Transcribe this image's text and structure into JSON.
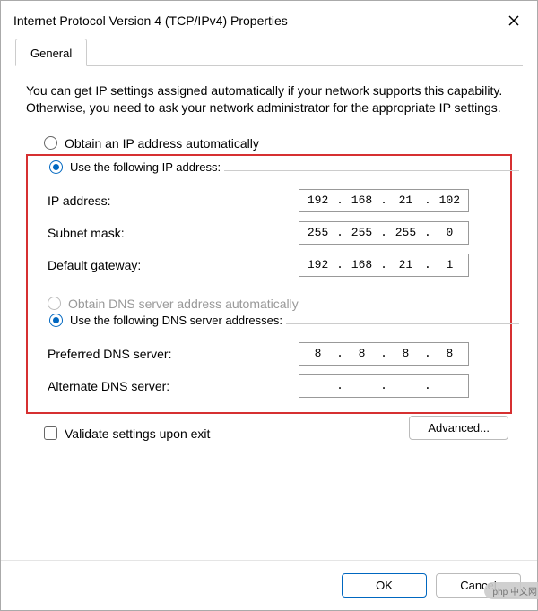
{
  "window": {
    "title": "Internet Protocol Version 4 (TCP/IPv4) Properties"
  },
  "tabs": {
    "general": "General"
  },
  "description": "You can get IP settings assigned automatically if your network supports this capability. Otherwise, you need to ask your network administrator for the appropriate IP settings.",
  "ip_section": {
    "radio_auto": "Obtain an IP address automatically",
    "radio_manual": "Use the following IP address:",
    "fields": {
      "ip_label": "IP address:",
      "ip_value": [
        "192",
        "168",
        "21",
        "102"
      ],
      "subnet_label": "Subnet mask:",
      "subnet_value": [
        "255",
        "255",
        "255",
        "0"
      ],
      "gateway_label": "Default gateway:",
      "gateway_value": [
        "192",
        "168",
        "21",
        "1"
      ]
    }
  },
  "dns_section": {
    "radio_auto": "Obtain DNS server address automatically",
    "radio_manual": "Use the following DNS server addresses:",
    "fields": {
      "preferred_label": "Preferred DNS server:",
      "preferred_value": [
        "8",
        "8",
        "8",
        "8"
      ],
      "alternate_label": "Alternate DNS server:",
      "alternate_value": [
        "",
        "",
        "",
        ""
      ]
    }
  },
  "validate_checkbox": "Validate settings upon exit",
  "buttons": {
    "advanced": "Advanced...",
    "ok": "OK",
    "cancel": "Cancel"
  },
  "watermark": "php 中文网"
}
